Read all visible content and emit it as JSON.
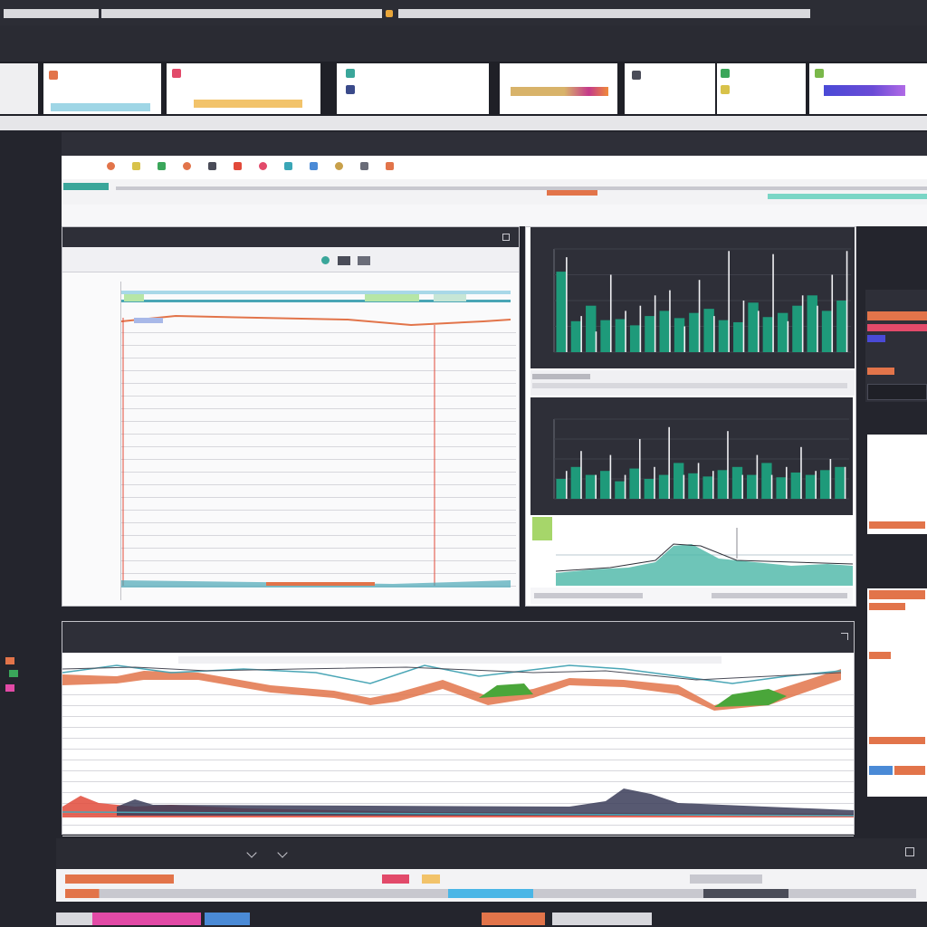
{
  "window": {
    "title": ""
  },
  "menu": {
    "items": [
      {
        "label": ""
      },
      {
        "label": ""
      },
      {
        "label": ""
      },
      {
        "label": ""
      },
      {
        "label": ""
      },
      {
        "label": ""
      },
      {
        "label": ""
      },
      {
        "label": ""
      },
      {
        "label": ""
      },
      {
        "label": ""
      },
      {
        "label": ""
      },
      {
        "label": ""
      },
      {
        "label": ""
      },
      {
        "label": ""
      },
      {
        "label": ""
      },
      {
        "label": ""
      },
      {
        "label": ""
      },
      {
        "label": ""
      },
      {
        "label": ""
      },
      {
        "label": ""
      }
    ]
  },
  "ribbon": {
    "groups": [
      {
        "label": ""
      },
      {
        "label": ""
      },
      {
        "label": ""
      },
      {
        "label": ""
      },
      {
        "label": ""
      },
      {
        "label": ""
      },
      {
        "label": ""
      },
      {
        "label": ""
      }
    ]
  },
  "document": {
    "title": ""
  },
  "sheet": {
    "title": ""
  },
  "chart_panel_main": {
    "title": "",
    "row_labels": [
      "",
      "",
      "",
      "",
      "",
      "",
      "",
      "",
      "",
      "",
      "",
      "",
      "",
      "",
      "",
      "",
      "",
      "",
      "",
      "",
      "",
      "",
      "",
      ""
    ]
  },
  "bar_chart_top": {
    "title": ""
  },
  "bar_chart_bottom": {
    "title": ""
  },
  "area_chart_small": {
    "title": ""
  },
  "trend_panel": {
    "title": "",
    "subtitle": ""
  },
  "right_panel": {
    "title": ""
  },
  "side_note": {
    "title": ""
  },
  "footer": {
    "title": ""
  },
  "icons": [
    "bold-icon",
    "italic-icon",
    "color-icon",
    "chart-icon",
    "table-icon",
    "filter-icon",
    "sort-icon",
    "zoom-icon"
  ],
  "colors": {
    "accent_teal": "#1e9a7a",
    "accent_orange": "#e2744a",
    "accent_green": "#4aa63a",
    "accent_purple": "#6a4bd6",
    "frame_dark": "#24252d"
  },
  "chart_data": [
    {
      "type": "bar",
      "series": [
        {
          "values": [
            0.78,
            0.3,
            0.45,
            0.31,
            0.32,
            0.26,
            0.35,
            0.4,
            0.33,
            0.38,
            0.42,
            0.31,
            0.29,
            0.48,
            0.34,
            0.38,
            0.45,
            0.55,
            0.4,
            0.5
          ]
        },
        {
          "values": [
            0.92,
            0.35,
            0.2,
            0.75,
            0.4,
            0.45,
            0.55,
            0.6,
            0.25,
            0.7,
            0.35,
            0.98,
            0.5,
            0.4,
            0.95,
            0.3,
            0.55,
            0.45,
            0.75,
            0.98
          ]
        }
      ]
    },
    {
      "type": "bar",
      "series": [
        {
          "values": [
            0.25,
            0.4,
            0.3,
            0.35,
            0.22,
            0.38,
            0.25,
            0.3,
            0.45,
            0.32,
            0.28,
            0.36,
            0.4,
            0.3,
            0.45,
            0.27,
            0.33,
            0.3,
            0.36,
            0.4
          ]
        },
        {
          "values": [
            0.35,
            0.6,
            0.3,
            0.55,
            0.3,
            0.75,
            0.4,
            0.9,
            0.3,
            0.45,
            0.35,
            0.85,
            0.3,
            0.55,
            0.3,
            0.4,
            0.65,
            0.35,
            0.5,
            0.4
          ]
        }
      ]
    }
  ]
}
